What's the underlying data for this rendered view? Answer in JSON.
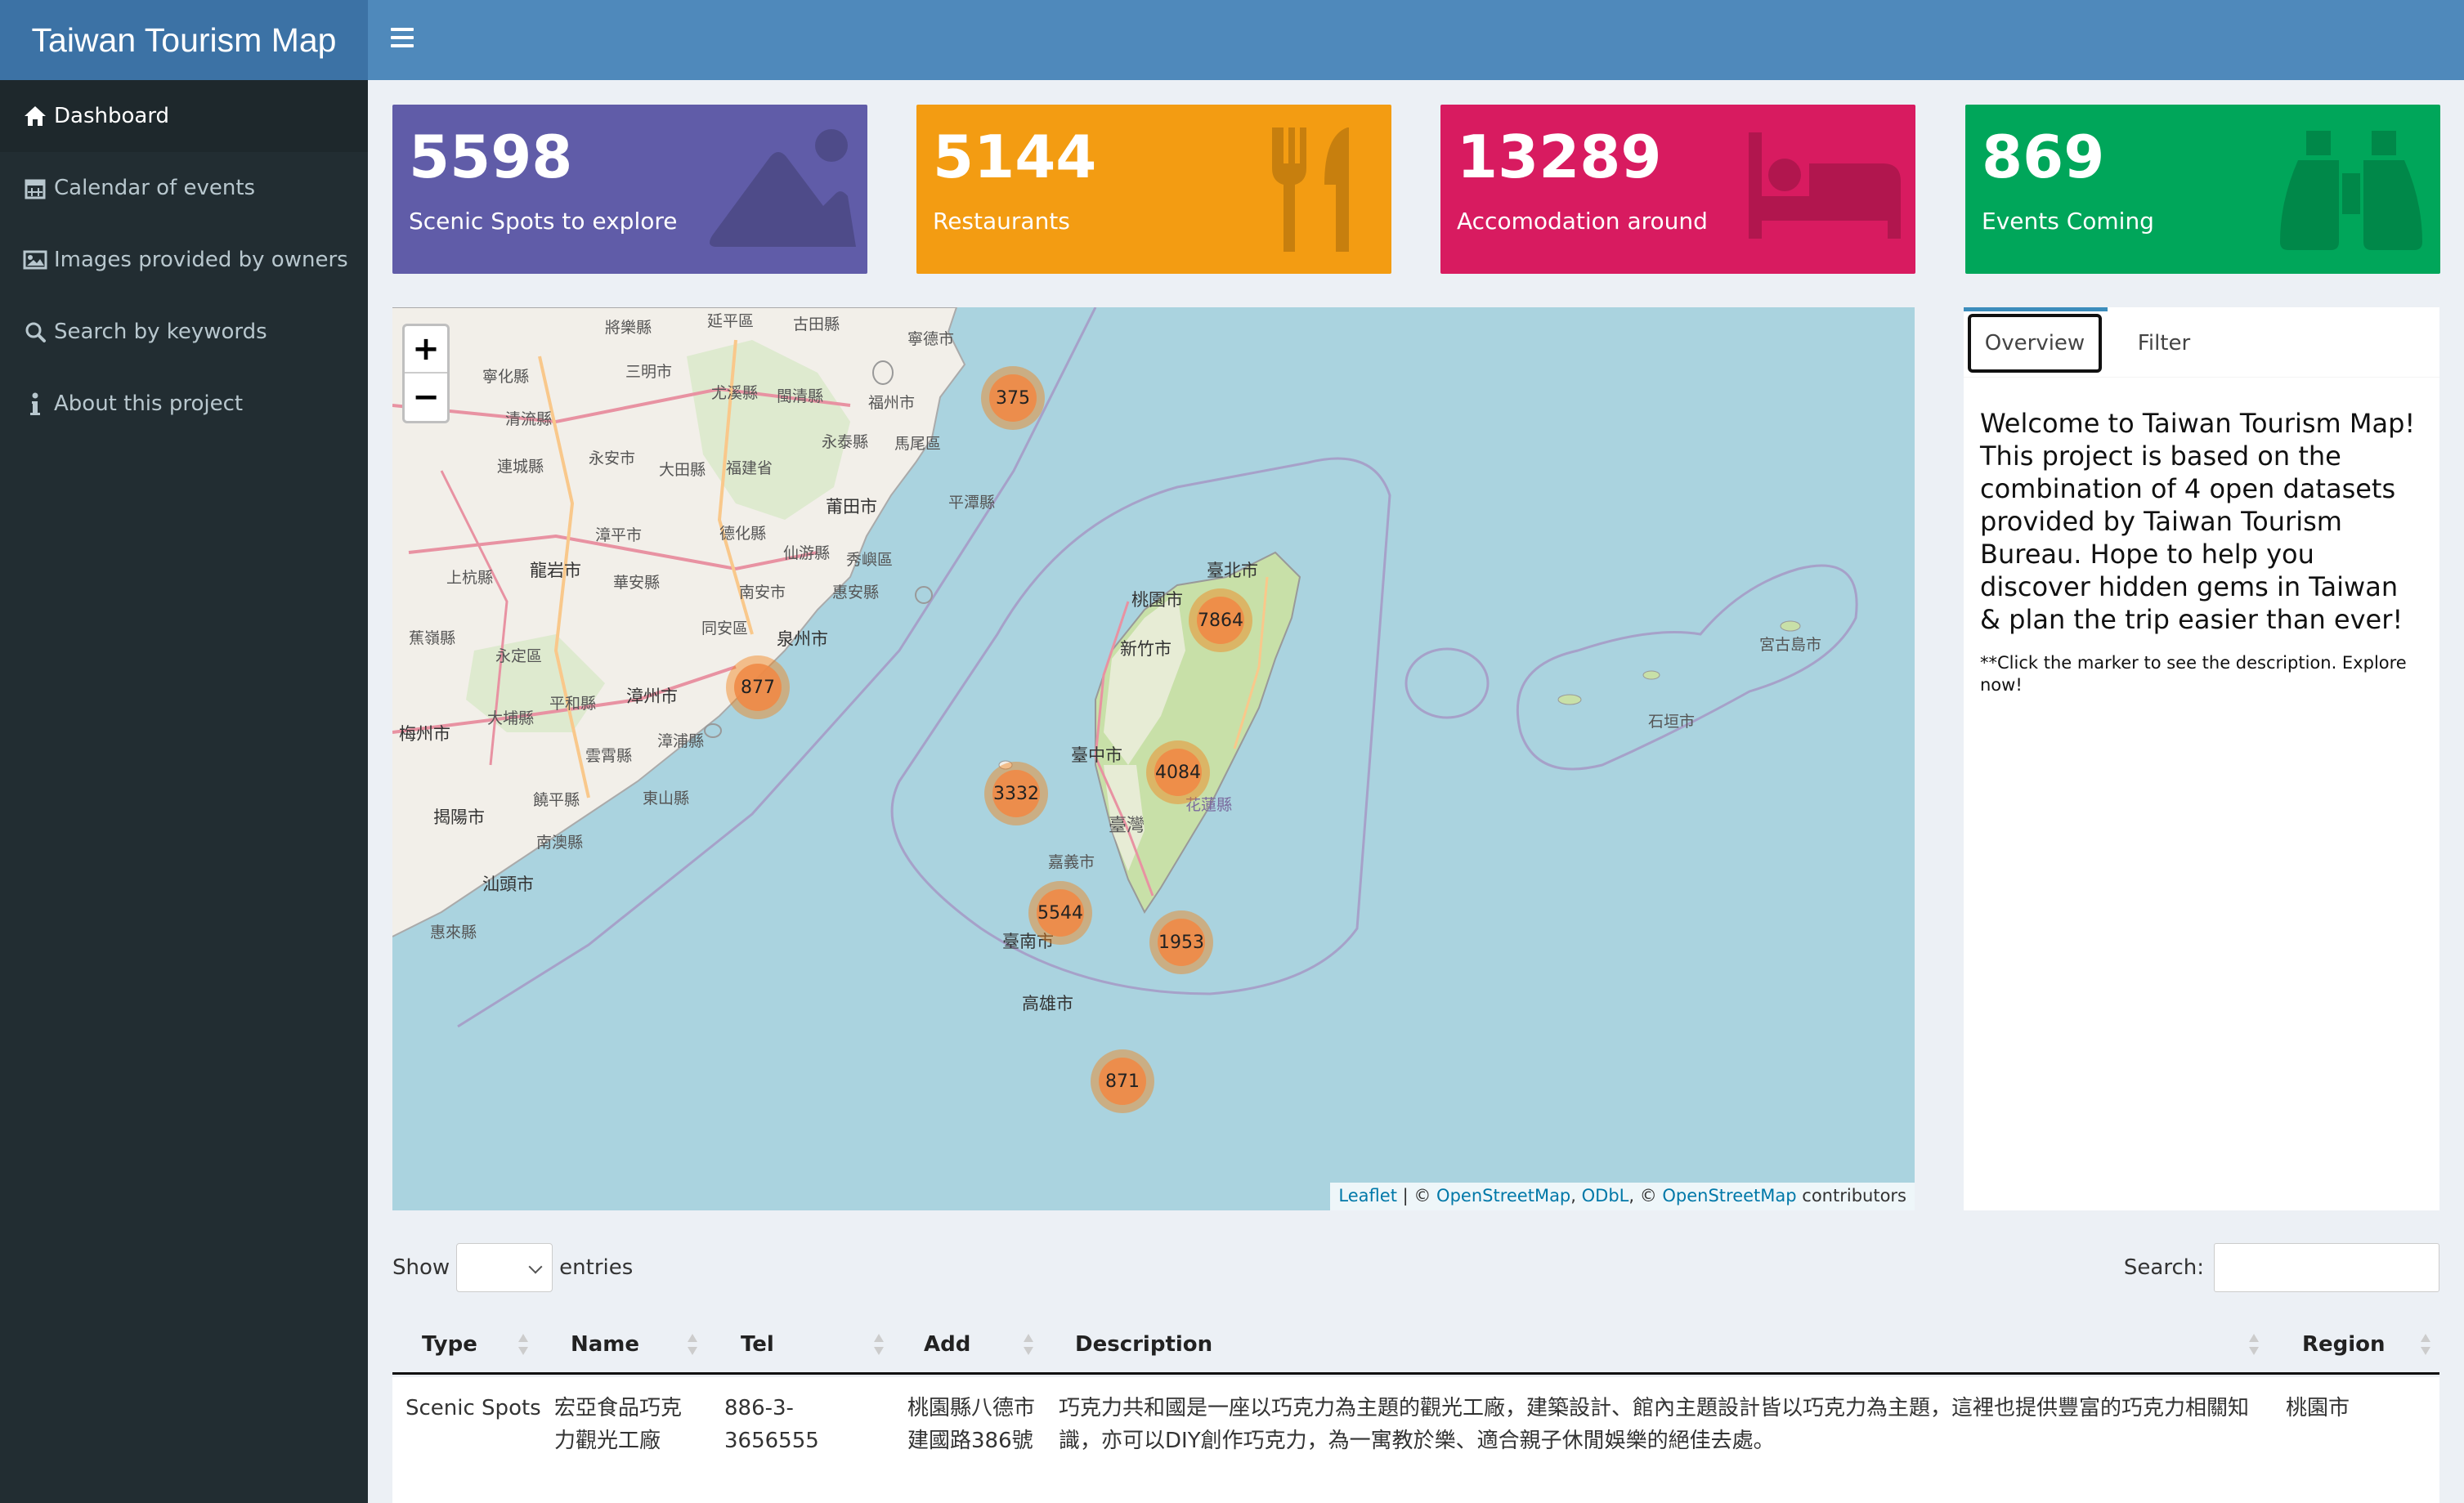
{
  "header": {
    "app_title": "Taiwan Tourism Map"
  },
  "sidebar": {
    "items": [
      {
        "label": "Dashboard",
        "icon": "home-icon"
      },
      {
        "label": "Calendar of events",
        "icon": "calendar-icon"
      },
      {
        "label": "Images provided by owners",
        "icon": "image-icon"
      },
      {
        "label": "Search by keywords",
        "icon": "search-icon"
      },
      {
        "label": "About this project",
        "icon": "info-icon"
      }
    ]
  },
  "value_boxes": [
    {
      "value": "5598",
      "label": "Scenic Spots to explore",
      "color": "#605ca8",
      "icon": "mountain-icon"
    },
    {
      "value": "5144",
      "label": "Restaurants",
      "color": "#f39c12",
      "icon": "cutlery-icon"
    },
    {
      "value": "13289",
      "label": "Accomodation around",
      "color": "#d81b60",
      "icon": "bed-icon"
    },
    {
      "value": "869",
      "label": "Events Coming",
      "color": "#00a65a",
      "icon": "binoculars-icon"
    }
  ],
  "map": {
    "zoom_in": "+",
    "zoom_out": "−",
    "clusters": [
      "375",
      "877",
      "7864",
      "4084",
      "3332",
      "5544",
      "1953",
      "871"
    ],
    "place_labels": [
      "將樂縣",
      "延平區",
      "古田縣",
      "寧德市",
      "寧化縣",
      "三明市",
      "尤溪縣",
      "閩清縣",
      "福州市",
      "清流縣",
      "永泰縣",
      "馬尾區",
      "連城縣",
      "永安市",
      "大田縣",
      "福建省",
      "莆田市",
      "平潭縣",
      "漳平市",
      "德化縣",
      "仙游縣",
      "秀嶼區",
      "上杭縣",
      "龍岩市",
      "華安縣",
      "南安市",
      "惠安縣",
      "臺北市",
      "桃園市",
      "蕉嶺縣",
      "永定區",
      "同安區",
      "泉州市",
      "新竹市",
      "宮古島市",
      "平和縣",
      "漳州市",
      "梅州市",
      "大埔縣",
      "漳浦縣",
      "石垣市",
      "雲霄縣",
      "東山縣",
      "臺中市",
      "揭陽市",
      "饒平縣",
      "臺灣",
      "花蓮縣",
      "南澳縣",
      "嘉義市",
      "汕頭市",
      "惠來縣",
      "臺南市",
      "高雄市"
    ],
    "attribution": {
      "leaflet": "Leaflet",
      "sep1": " | © ",
      "osm": "OpenStreetMap",
      "comma": ", ",
      "odbl": "ODbL",
      "sep2": ", © ",
      "osm2": "OpenStreetMap",
      "tail": " contributors"
    }
  },
  "panel": {
    "tabs": [
      "Overview",
      "Filter"
    ],
    "welcome": "Welcome to Taiwan Tourism Map! This project is based on the combination of 4 open datasets provided by Taiwan Tourism Bureau. Hope to help you discover hidden gems in Taiwan & plan the trip easier than ever!",
    "note": "**Click the marker to see the description. Explore now!"
  },
  "table_controls": {
    "show_label": "Show",
    "entries_label": "entries",
    "search_label": "Search:"
  },
  "table": {
    "columns": [
      "Type",
      "Name",
      "Tel",
      "Add",
      "Description",
      "Region"
    ],
    "rows": [
      {
        "type": "Scenic Spots",
        "name": "宏亞食品巧克力觀光工廠",
        "tel": "886-3-3656555",
        "add": "桃園縣八德市建國路386號",
        "description": "巧克力共和國是一座以巧克力為主題的觀光工廠，建築設計、館內主題設計皆以巧克力為主題，這裡也提供豐富的巧克力相關知識，亦可以DIY創作巧克力，為一寓教於樂、適合親子休閒娛樂的絕佳去處。",
        "region": "桃園市"
      }
    ]
  }
}
